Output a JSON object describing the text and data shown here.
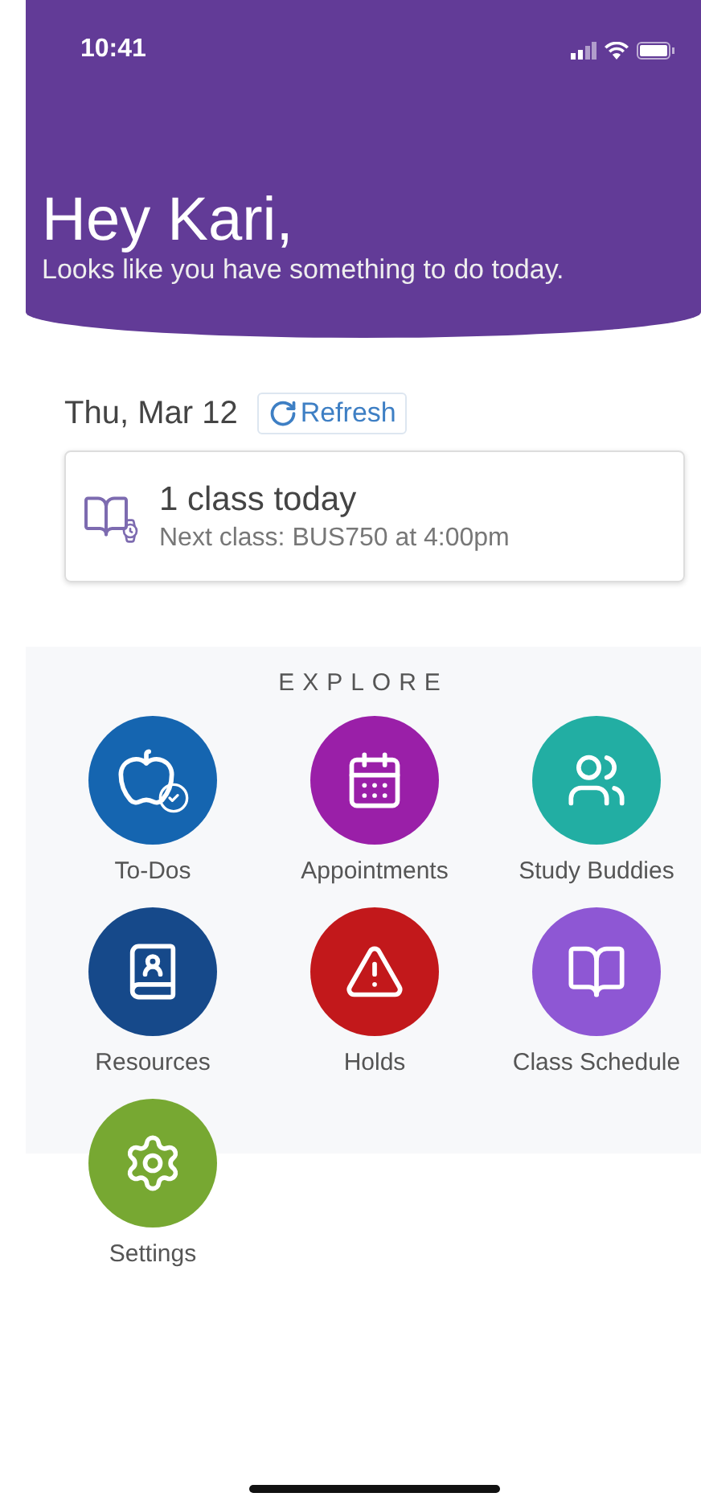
{
  "status_bar": {
    "time": "10:41"
  },
  "header": {
    "greeting": "Hey Kari,",
    "subtitle": "Looks like you have something to do today."
  },
  "today": {
    "date": "Thu, Mar 12",
    "refresh": "Refresh",
    "card": {
      "title": "1 class today",
      "detail": "Next class: BUS750 at 4:00pm"
    }
  },
  "explore": {
    "title": "EXPLORE",
    "tiles": [
      {
        "label": "To-Dos",
        "kind": "todos",
        "color": "#1565b0"
      },
      {
        "label": "Appointments",
        "kind": "appointments",
        "color": "#9a1fa8"
      },
      {
        "label": "Study Buddies",
        "kind": "buddies",
        "color": "#22aea3"
      },
      {
        "label": "Resources",
        "kind": "resources",
        "color": "#16498a"
      },
      {
        "label": "Holds",
        "kind": "holds",
        "color": "#c2181b"
      },
      {
        "label": "Class Schedule",
        "kind": "schedule",
        "color": "#8e57d4"
      },
      {
        "label": "Settings",
        "kind": "settings",
        "color": "#77a832"
      }
    ]
  }
}
